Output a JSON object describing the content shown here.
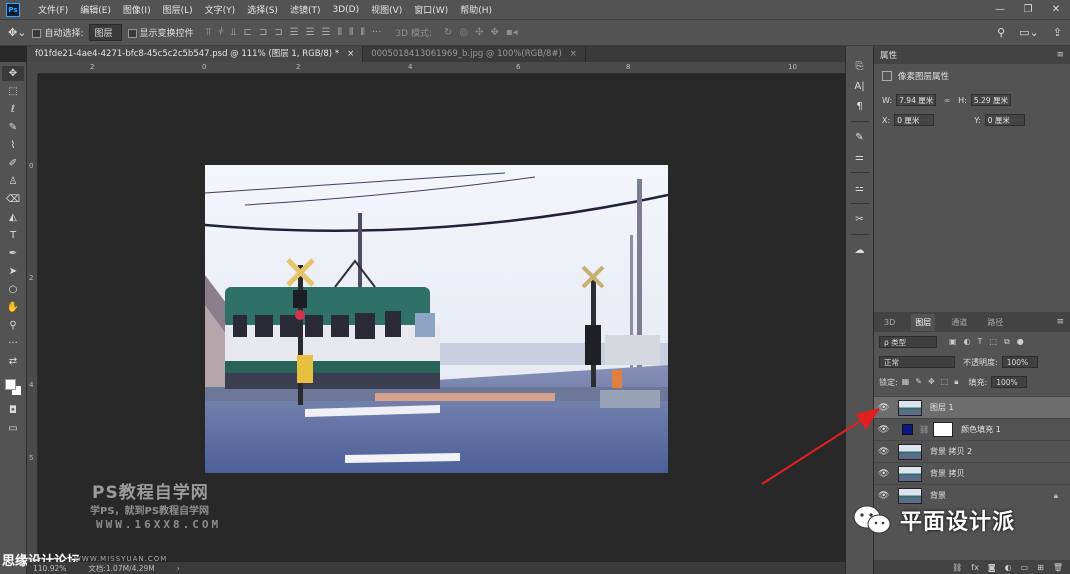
{
  "app": {
    "logo": "Ps"
  },
  "menu": [
    "文件(F)",
    "编辑(E)",
    "图像(I)",
    "图层(L)",
    "文字(Y)",
    "选择(S)",
    "滤镜(T)",
    "3D(D)",
    "视图(V)",
    "窗口(W)",
    "帮助(H)"
  ],
  "window_controls": {
    "minimize": "—",
    "restore": "❐",
    "close": "✕"
  },
  "options": {
    "auto_select_label": "自动选择:",
    "auto_select_target": "图层",
    "show_transform_label": "显示变换控件",
    "mode_3d_label": "3D 模式:"
  },
  "tabs": [
    {
      "title": "f01fde21-4ae4-4271-bfc8-45c5c2c5b547.psd @ 111% (图层 1, RGB/8) *",
      "close": "×"
    },
    {
      "title": "000501841306​1969_b.jpg @ 100%(RGB/8#)",
      "close": "×"
    }
  ],
  "ruler_h_labels": [
    "2",
    "0",
    "2",
    "4",
    "6",
    "8",
    "10"
  ],
  "ruler_v_labels": [
    "0",
    "2",
    "4",
    "5"
  ],
  "status": {
    "zoom": "110.92%",
    "doc_size": "文档:1.07M/4.29M",
    "arrow": "›"
  },
  "watermark": {
    "title": "PS教程自学网",
    "subtitle": "学PS，就到PS教程自学网",
    "url": "WWW.16XX8.COM",
    "corner_text": "思缘设计论坛",
    "corner_url": "WWW.MISSYUAN.COM"
  },
  "properties": {
    "tab": "属性",
    "type_label": "像素图层属性",
    "w_label": "W:",
    "w_value": "7.94 厘米",
    "h_label": "H:",
    "h_value": "5.29 厘米",
    "x_label": "X:",
    "x_value": "0 厘米",
    "y_label": "Y:",
    "y_value": "0 厘米"
  },
  "layers_panel": {
    "tabs": [
      "3D",
      "图层",
      "通道",
      "路径"
    ],
    "kind_filter": "ρ 类型",
    "blend_mode": "正常",
    "opacity_label": "不透明度:",
    "opacity_value": "100%",
    "lock_label": "锁定:",
    "fill_label": "填充:",
    "fill_value": "100%",
    "layers": [
      {
        "name": "图层 1",
        "selected": true
      },
      {
        "name": "颜色填充 1",
        "fill_color": "#0c1580"
      },
      {
        "name": "背景 拷贝 2"
      },
      {
        "name": "背景 拷贝"
      },
      {
        "name": "背景",
        "locked": true
      }
    ]
  },
  "wechat": {
    "label": "平面设计派"
  },
  "colors": {
    "accent_arrow": "#e02020",
    "fill_layer": "#0c1580",
    "foreground": "#ffffff",
    "background": "#ffffff"
  }
}
